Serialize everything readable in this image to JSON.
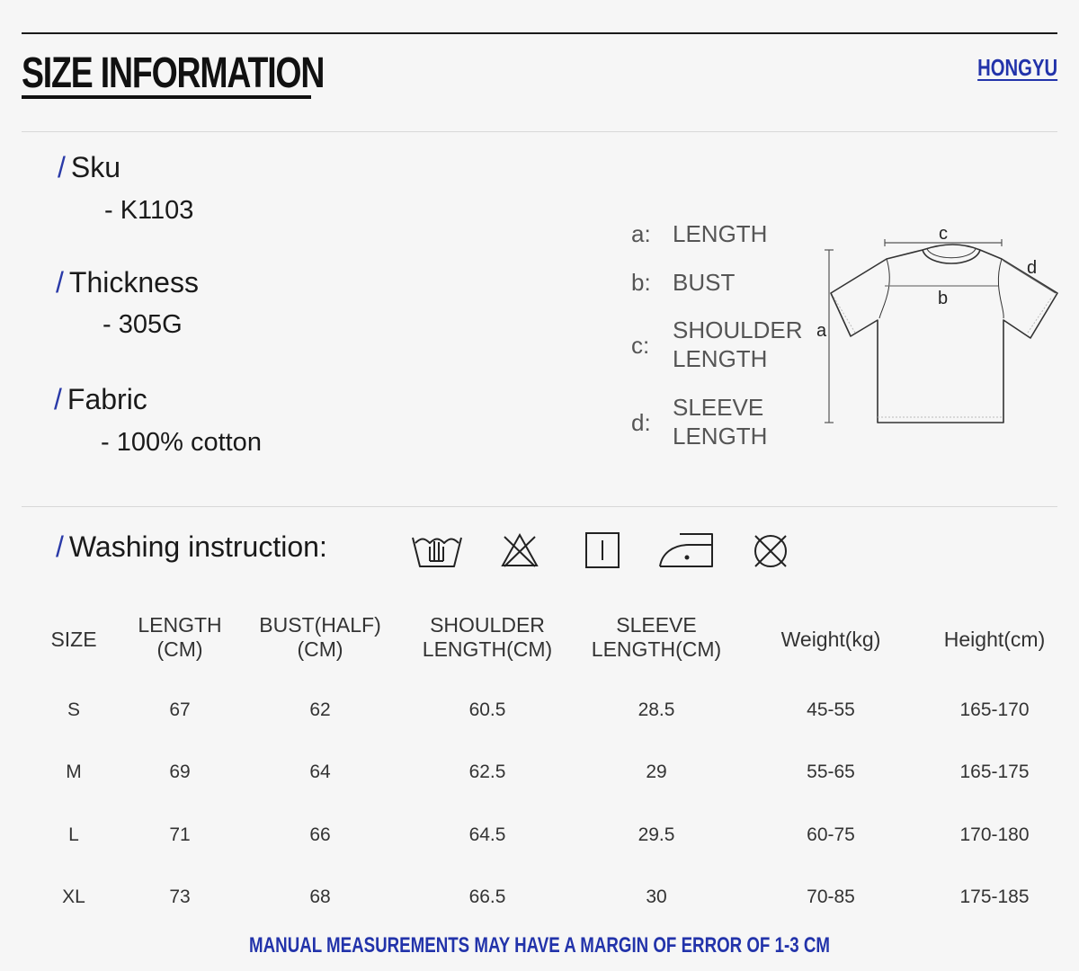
{
  "header": {
    "title": "SIZE INFORMATION",
    "brand": "HONGYU"
  },
  "specs": [
    {
      "label": "Sku",
      "value": "- K1103"
    },
    {
      "label": "Thickness",
      "value": "- 305G"
    },
    {
      "label": "Fabric",
      "value": "- 100% cotton"
    }
  ],
  "slash": "/",
  "legend": [
    {
      "key": "a:",
      "lines": [
        "LENGTH"
      ]
    },
    {
      "key": "b:",
      "lines": [
        "BUST"
      ]
    },
    {
      "key": "c:",
      "lines": [
        "SHOULDER",
        "LENGTH"
      ]
    },
    {
      "key": "d:",
      "lines": [
        "SLEEVE",
        "LENGTH"
      ]
    }
  ],
  "diagram_labels": {
    "a": "a",
    "b": "b",
    "c": "c",
    "d": "d"
  },
  "washing": {
    "heading": "Washing instruction:",
    "icons": [
      "hand-wash-icon",
      "do-not-bleach-icon",
      "tumble-dry-line-icon",
      "iron-icon",
      "do-not-dry-clean-icon"
    ]
  },
  "table": {
    "headers": [
      "SIZE",
      "LENGTH\n(CM)",
      "BUST(HALF)\n(CM)",
      "SHOULDER\nLENGTH(CM)",
      "SLEEVE\nLENGTH(CM)",
      "Weight(kg)",
      "Height(cm)"
    ],
    "rows": [
      [
        "S",
        "67",
        "62",
        "60.5",
        "28.5",
        "45-55",
        "165-170"
      ],
      [
        "M",
        "69",
        "64",
        "62.5",
        "29",
        "55-65",
        "165-175"
      ],
      [
        "L",
        "71",
        "66",
        "64.5",
        "29.5",
        "60-75",
        "170-180"
      ],
      [
        "XL",
        "73",
        "68",
        "66.5",
        "30",
        "70-85",
        "175-185"
      ]
    ]
  },
  "note": "MANUAL MEASUREMENTS MAY HAVE A MARGIN OF ERROR OF 1-3 CM",
  "colors": {
    "accent": "#2233aa",
    "text": "#222222",
    "background": "#f6f6f6"
  }
}
